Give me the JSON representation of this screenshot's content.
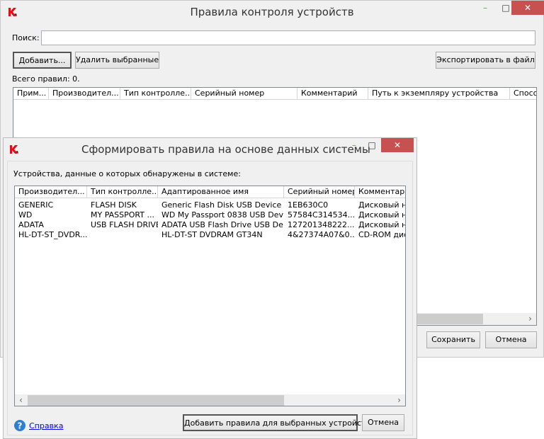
{
  "main_window": {
    "title": "Правила контроля устройств",
    "search_label": "Поиск:",
    "search_value": "",
    "add_button": "Добавить...",
    "delete_button": "Удалить выбранные",
    "export_button": "Экспортировать в файл",
    "total_rules": "Всего правил: 0.",
    "columns": [
      "Прим...",
      "Производител...",
      "Тип контролле...",
      "Серийный номер",
      "Комментарий",
      "Путь к экземпляру устройства",
      "Спосо"
    ],
    "save_button": "Сохранить",
    "cancel_button": "Отмена",
    "minimize": "–",
    "maximize": "□",
    "close": "✕"
  },
  "dialog": {
    "title": "Сформировать правила на основе данных системы",
    "label": "Устройства, данные о которых обнаружены в системе:",
    "columns": [
      "Производител...",
      "Тип контролле...",
      "Адаптированное имя",
      "Серийный номер",
      "Комментарий"
    ],
    "rows": [
      [
        "GENERIC",
        "FLASH DISK",
        "Generic Flash Disk USB Device",
        "1EB630C0",
        "Дисковый на"
      ],
      [
        "WD",
        "MY PASSPORT ...",
        "WD My Passport 0838 USB Device",
        "57584C314534...",
        "Дисковый на"
      ],
      [
        "ADATA",
        "USB FLASH DRIVE",
        "ADATA USB Flash Drive USB De...",
        "127201348222...",
        "Дисковый на"
      ],
      [
        "HL-DT-ST_DVDR...",
        "",
        "HL-DT-ST DVDRAM GT34N",
        "4&27374A07&0...",
        "CD-ROM дис"
      ]
    ],
    "help_link": "Справка",
    "add_rules_button": "Добавить правила для выбранных устройств",
    "cancel_button": "Отмена",
    "minimize": "–",
    "maximize": "□",
    "close": "✕"
  },
  "colors": {
    "close_red": "#c75050",
    "kaspersky_red": "#e0101a",
    "link": "#0000ee"
  }
}
